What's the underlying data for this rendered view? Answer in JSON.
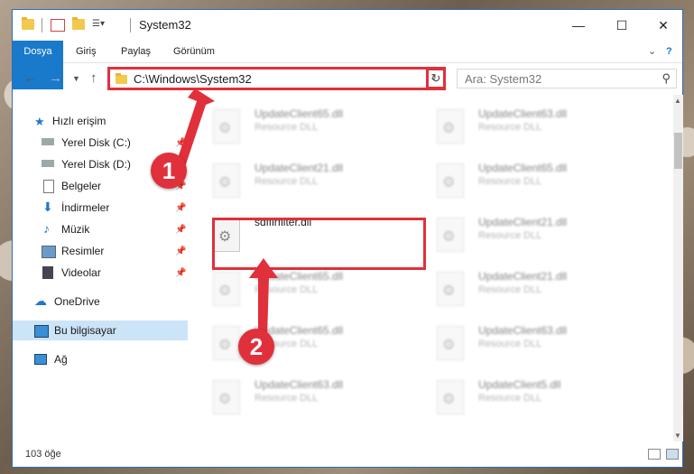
{
  "window": {
    "title": "System32",
    "minimize_glyph": "—",
    "maximize_glyph": "☐",
    "close_glyph": "✕",
    "help_glyph": "?"
  },
  "ribbon": {
    "tabs": [
      "Dosya",
      "Giriş",
      "Paylaş",
      "Görünüm"
    ],
    "expand_glyph": "⌄"
  },
  "address": {
    "path": "C:\\Windows\\System32",
    "search_placeholder": "Ara: System32"
  },
  "navigation": {
    "quick_access": "Hızlı erişim",
    "items": [
      {
        "label": "Yerel Disk (C:)",
        "icon": "drive-icon",
        "pinned": true
      },
      {
        "label": "Yerel Disk (D:)",
        "icon": "drive-icon",
        "pinned": false
      },
      {
        "label": "Belgeler",
        "icon": "documents-icon",
        "pinned": true
      },
      {
        "label": "İndirmeler",
        "icon": "download-icon",
        "pinned": true
      },
      {
        "label": "Müzik",
        "icon": "music-icon",
        "pinned": true
      },
      {
        "label": "Resimler",
        "icon": "pictures-icon",
        "pinned": true
      },
      {
        "label": "Videolar",
        "icon": "videos-icon",
        "pinned": true
      }
    ],
    "onedrive": "OneDrive",
    "this_pc": "Bu bilgisayar",
    "network": "Ağ"
  },
  "files": {
    "col1": [
      {
        "name": "UpdateClient65.dll",
        "desc": "Resource DLL"
      },
      {
        "name": "UpdateClient21.dll",
        "desc": "Resource DLL"
      },
      {
        "name": "sdffirfilter.dll",
        "desc": ""
      },
      {
        "name": "UpdateClient65.dll",
        "desc": "Resource DLL"
      },
      {
        "name": "UpdateClient65.dll",
        "desc": "Resource DLL"
      },
      {
        "name": "UpdateClient63.dll",
        "desc": "Resource DLL"
      }
    ],
    "col2": [
      {
        "name": "UpdateClient63.dll",
        "desc": "Resource DLL"
      },
      {
        "name": "UpdateClient65.dll",
        "desc": "Resource DLL"
      },
      {
        "name": "UpdateClient21.dll",
        "desc": "Resource DLL"
      },
      {
        "name": "UpdateClient21.dll",
        "desc": "Resource DLL"
      },
      {
        "name": "UpdateClient63.dll",
        "desc": "Resource DLL"
      },
      {
        "name": "UpdateClient5.dll",
        "desc": "Resource DLL"
      }
    ]
  },
  "annotations": {
    "step1": "1",
    "step2": "2"
  },
  "status": {
    "count": "103 öğe"
  },
  "colors": {
    "accent": "#1979ca",
    "annotation_red": "#e0303b",
    "selection": "#cce4f7"
  }
}
